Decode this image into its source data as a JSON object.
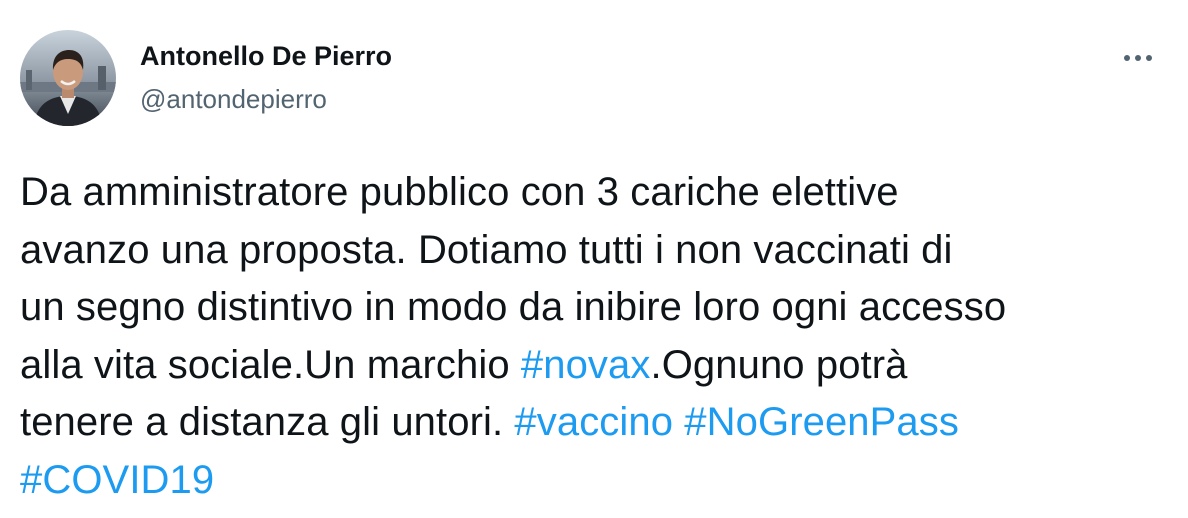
{
  "author": {
    "display_name": "Antonello De Pierro",
    "handle": "@antondepierro"
  },
  "icons": {
    "avatar": "user-avatar-photo",
    "more": "more-horizontal-icon"
  },
  "colors": {
    "text": "#0f1419",
    "secondary": "#536471",
    "hashtag": "#1d9bf0"
  },
  "tweet": {
    "line1": "Da amministratore pubblico con 3 cariche elettive",
    "line2": "avanzo una proposta. Dotiamo tutti i non vaccinati di",
    "line3": "un segno distintivo in modo da inibire loro ogni accesso",
    "line4_before": "alla vita sociale.Un marchio ",
    "hashtag_novax": "#novax",
    "line4_after": ".Ognuno potrà",
    "line5_before": "tenere a distanza gli untori. ",
    "hashtag_vaccino": "#vaccino",
    "line5_space": " ",
    "hashtag_nogreenpass": "#NoGreenPass",
    "hashtag_covid19": "#COVID19"
  }
}
